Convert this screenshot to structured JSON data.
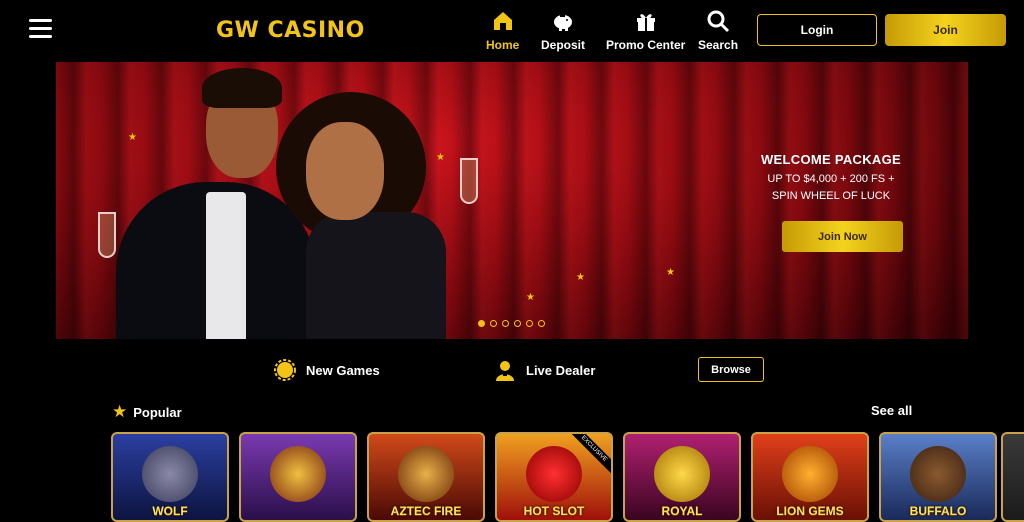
{
  "header": {
    "logo_text": "GW CASINO",
    "nav": [
      {
        "label": "Home",
        "icon": "home-icon",
        "active": true
      },
      {
        "label": "Deposit",
        "icon": "piggy-bank-icon"
      },
      {
        "label": "Promo Center",
        "icon": "gift-icon"
      },
      {
        "label": "Search",
        "icon": "search-icon"
      }
    ],
    "login_label": "Login",
    "join_label": "Join"
  },
  "hero": {
    "title": "WELCOME PACKAGE",
    "subtitle_line1": "UP TO $4,000 + 200 FS +",
    "subtitle_line2": "SPIN WHEEL OF LUCK",
    "cta_label": "Join Now",
    "slides_count": 6,
    "active_slide": 1
  },
  "categories": {
    "new_games_label": "New Games",
    "live_dealer_label": "Live Dealer",
    "browse_label": "Browse"
  },
  "popular": {
    "title": "Popular",
    "see_all_label": "See all",
    "games": [
      {
        "name": "WOLF",
        "bg": "#1b2a6b"
      },
      {
        "name": "",
        "bg": "#4a1f7a"
      },
      {
        "name": "AZTEC FIRE",
        "bg": "#8a1b10"
      },
      {
        "name": "HOT SLOT",
        "bg": "#c9261a",
        "badge": "EXCLUSIVE"
      },
      {
        "name": "ROYAL",
        "bg": "#7a0f3a"
      },
      {
        "name": "LION GEMS",
        "bg": "#b0300a"
      },
      {
        "name": "BUFFALO",
        "bg": "#3c5a9a"
      }
    ]
  },
  "colors": {
    "accent": "#f2c418",
    "hero_red": "#a3101a"
  }
}
